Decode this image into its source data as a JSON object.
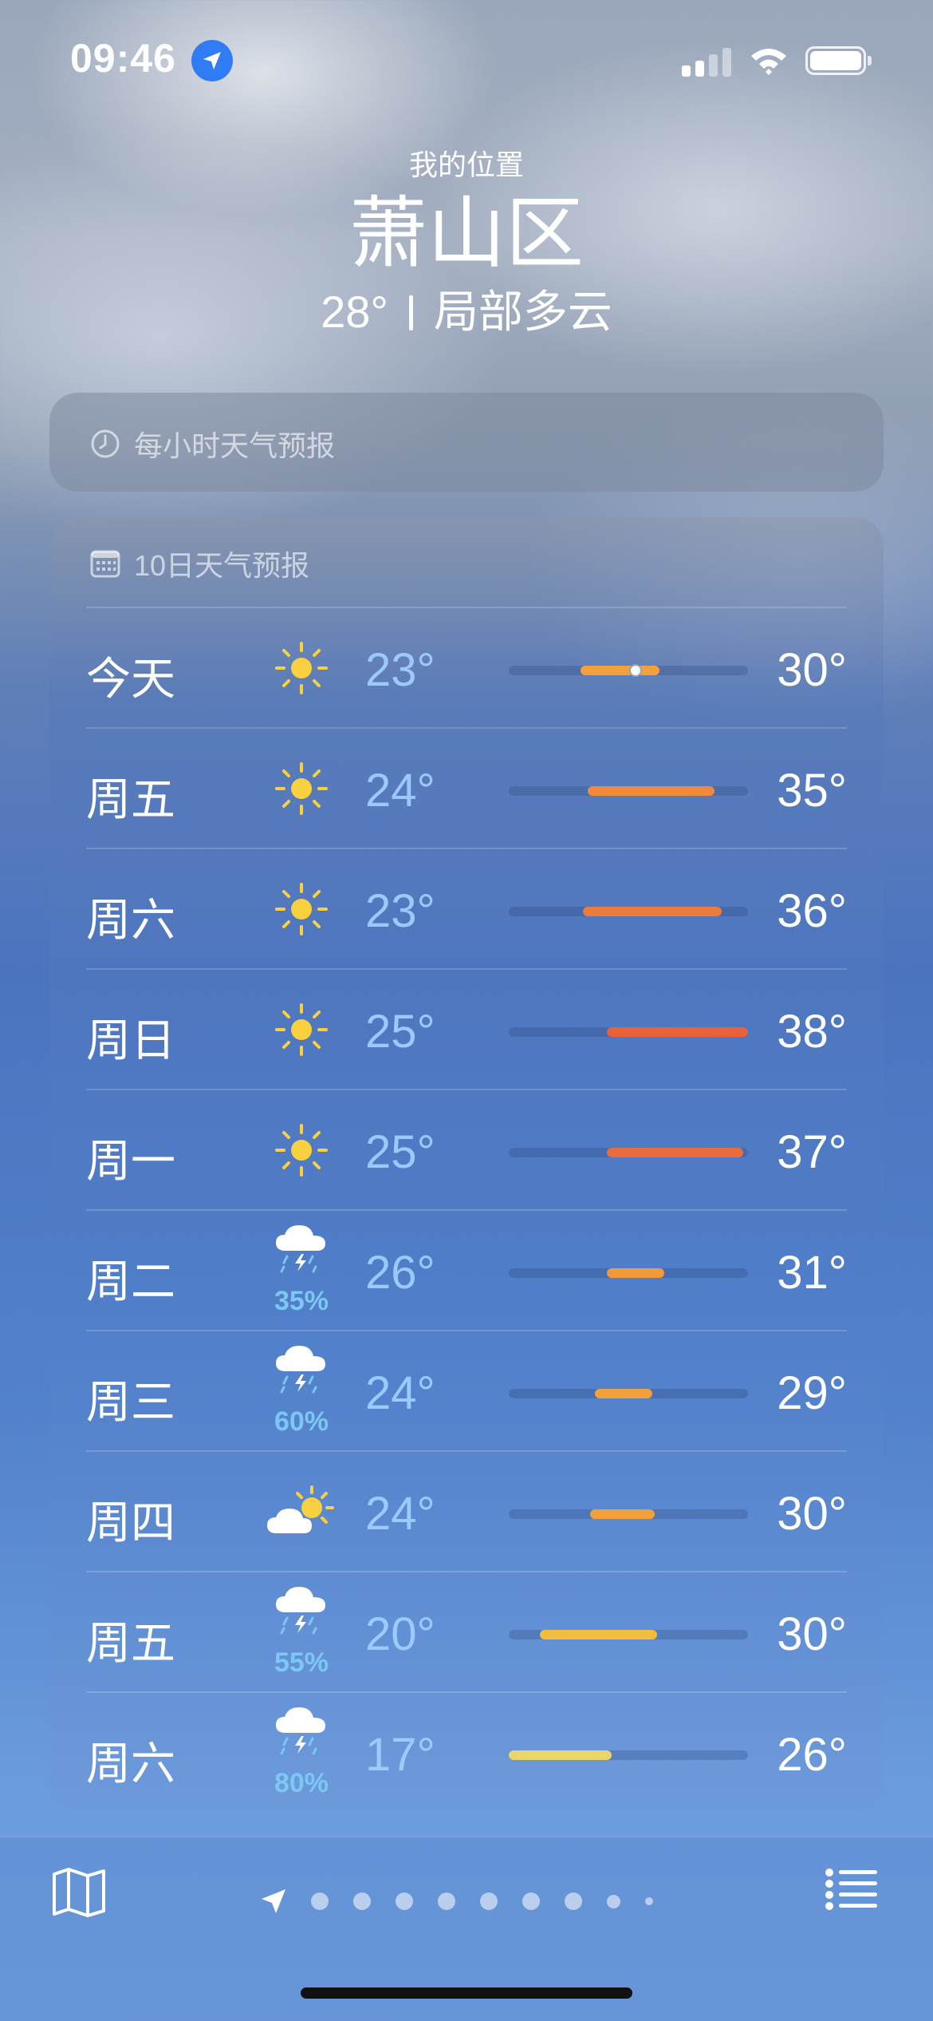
{
  "status_bar": {
    "time": "09:46"
  },
  "header": {
    "location_label": "我的位置",
    "city": "萧山区",
    "temperature": "28°",
    "condition": "局部多云"
  },
  "hourly": {
    "label": "每小时天气预报"
  },
  "daily": {
    "label": "10日天气预报",
    "range_min": 17,
    "range_max": 38,
    "current_temp": 28,
    "rows": [
      {
        "day": "今天",
        "icon": "sun-icon",
        "precip": "",
        "low": "23°",
        "high": "30°",
        "bar_from": 0.3,
        "bar_to": 0.63,
        "bar_color": "#f4a13c",
        "current_dot": true
      },
      {
        "day": "周五",
        "icon": "sun-icon",
        "precip": "",
        "low": "24°",
        "high": "35°",
        "bar_from": 0.33,
        "bar_to": 0.86,
        "bar_color": "#f08a3a"
      },
      {
        "day": "周六",
        "icon": "sun-icon",
        "precip": "",
        "low": "23°",
        "high": "36°",
        "bar_from": 0.31,
        "bar_to": 0.89,
        "bar_color": "#ee7a3b"
      },
      {
        "day": "周日",
        "icon": "sun-icon",
        "precip": "",
        "low": "25°",
        "high": "38°",
        "bar_from": 0.41,
        "bar_to": 1.0,
        "bar_color": "#e8613b"
      },
      {
        "day": "周一",
        "icon": "sun-icon",
        "precip": "",
        "low": "25°",
        "high": "37°",
        "bar_from": 0.41,
        "bar_to": 0.98,
        "bar_color": "#ea6b3b"
      },
      {
        "day": "周二",
        "icon": "thunderstorm-icon",
        "precip": "35%",
        "low": "26°",
        "high": "31°",
        "bar_from": 0.41,
        "bar_to": 0.65,
        "bar_color": "#f29a3a"
      },
      {
        "day": "周三",
        "icon": "thunderstorm-icon",
        "precip": "60%",
        "low": "24°",
        "high": "29°",
        "bar_from": 0.36,
        "bar_to": 0.6,
        "bar_color": "#f2a03a"
      },
      {
        "day": "周四",
        "icon": "partly-sunny-icon",
        "precip": "",
        "low": "24°",
        "high": "30°",
        "bar_from": 0.34,
        "bar_to": 0.61,
        "bar_color": "#f2a03a"
      },
      {
        "day": "周五",
        "icon": "thunderstorm-icon",
        "precip": "55%",
        "low": "20°",
        "high": "30°",
        "bar_from": 0.13,
        "bar_to": 0.62,
        "bar_color": "#f3bc3a"
      },
      {
        "day": "周六",
        "icon": "thunderstorm-icon",
        "precip": "80%",
        "low": "17°",
        "high": "26°",
        "bar_from": 0.0,
        "bar_to": 0.43,
        "bar_color": "#e9d56a"
      }
    ]
  },
  "bottom_bar": {
    "icons": [
      "map-icon",
      "location-arrow-icon",
      "list-icon"
    ],
    "page_count": 9,
    "current_page": 0
  }
}
